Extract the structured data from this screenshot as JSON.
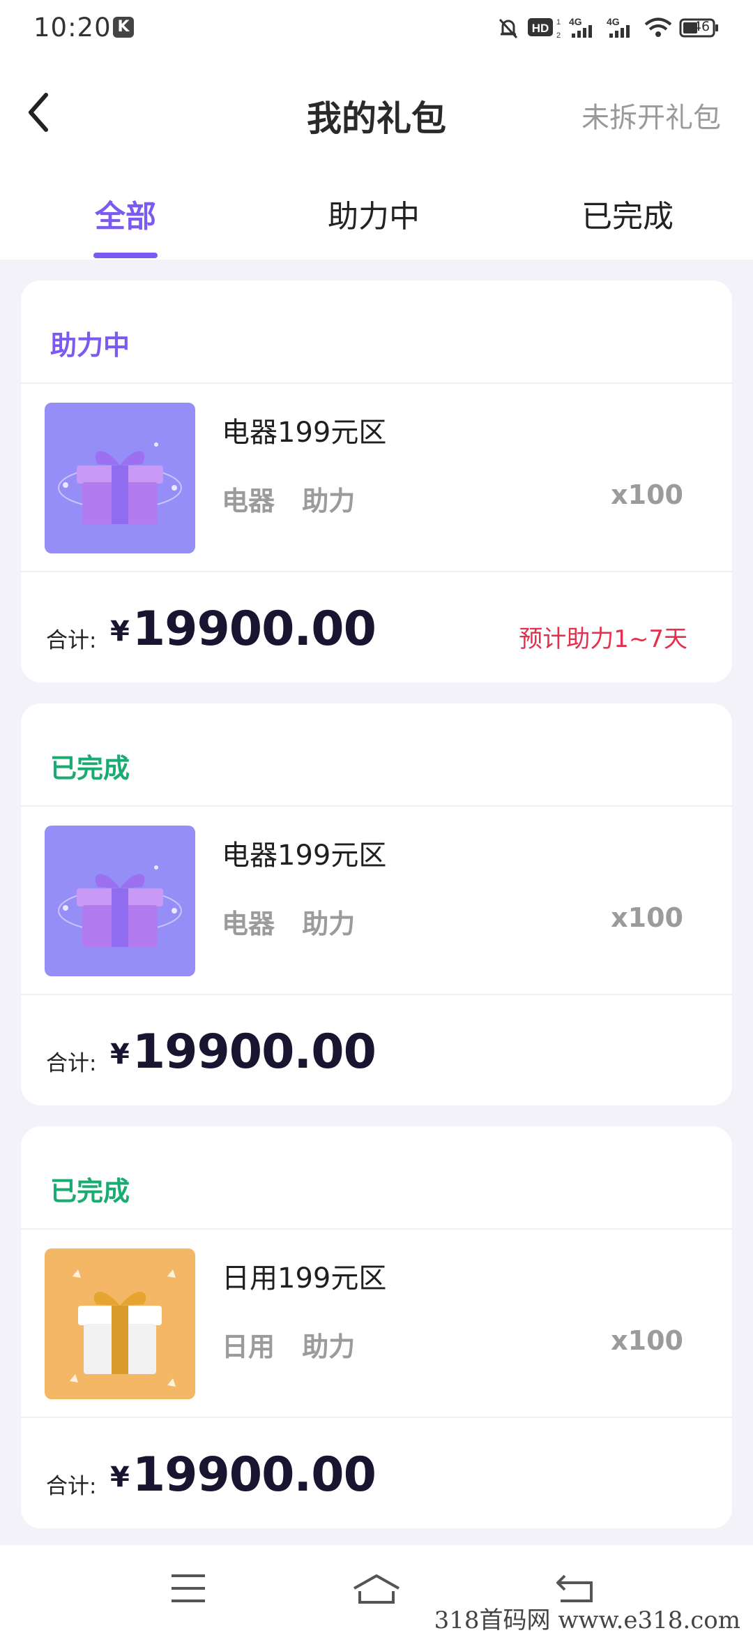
{
  "status_bar": {
    "time": "10:20",
    "battery": "46"
  },
  "header": {
    "title": "我的礼包",
    "action": "未拆开礼包"
  },
  "tabs": [
    {
      "label": "全部",
      "active": true
    },
    {
      "label": "助力中",
      "active": false
    },
    {
      "label": "已完成",
      "active": false
    }
  ],
  "orders": [
    {
      "status": "助力中",
      "status_color": "#7a5af0",
      "name": "电器199元区",
      "tags": [
        "电器",
        "助力"
      ],
      "qty": "x100",
      "total_label": "合计:",
      "currency": "¥",
      "total": "19900.00",
      "estimate": "预计助力1~7天",
      "thumb": "purple-gift-box"
    },
    {
      "status": "已完成",
      "status_color": "#1aab73",
      "name": "电器199元区",
      "tags": [
        "电器",
        "助力"
      ],
      "qty": "x100",
      "total_label": "合计:",
      "currency": "¥",
      "total": "19900.00",
      "thumb": "purple-gift-box"
    },
    {
      "status": "已完成",
      "status_color": "#1aab73",
      "name": "日用199元区",
      "tags": [
        "日用",
        "助力"
      ],
      "qty": "x100",
      "total_label": "合计:",
      "currency": "¥",
      "total": "19900.00",
      "thumb": "gold-gift-box"
    }
  ],
  "watermark": "318首码网 www.e318.com",
  "colors": {
    "accent": "#7a5af0",
    "completed": "#1aab73",
    "estimate": "#e2304d"
  }
}
